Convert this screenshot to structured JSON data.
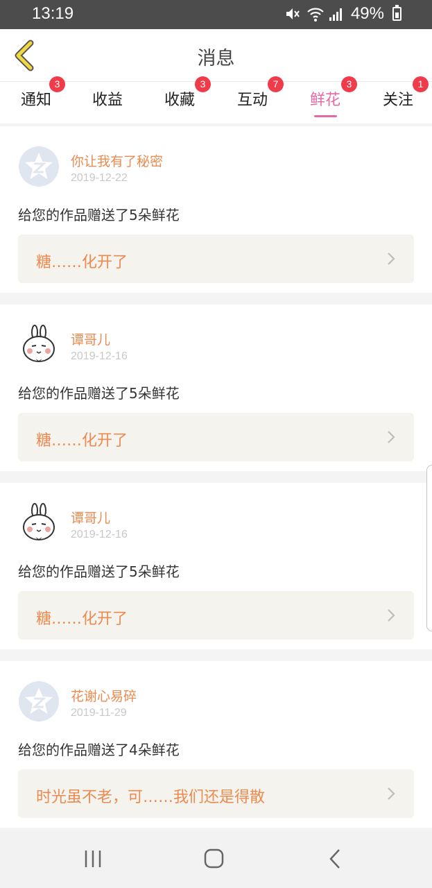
{
  "status_bar": {
    "time": "13:19",
    "battery": "49%"
  },
  "header": {
    "title": "消息"
  },
  "tabs": [
    {
      "label": "通知",
      "badge": "3",
      "active": false
    },
    {
      "label": "收益",
      "badge": "",
      "active": false
    },
    {
      "label": "收藏",
      "badge": "3",
      "active": false
    },
    {
      "label": "互动",
      "badge": "7",
      "active": false
    },
    {
      "label": "鲜花",
      "badge": "3",
      "active": true
    },
    {
      "label": "关注",
      "badge": "1",
      "active": false
    }
  ],
  "messages": [
    {
      "avatar": "qzone-avatar",
      "username": "你让我有了秘密",
      "date": "2019-12-22",
      "text": "给您的作品赠送了5朵鲜花",
      "work": "糖……化开了"
    },
    {
      "avatar": "rabbit-avatar",
      "username": "谭哥儿",
      "date": "2019-12-16",
      "text": "给您的作品赠送了5朵鲜花",
      "work": "糖……化开了"
    },
    {
      "avatar": "rabbit-avatar",
      "username": "谭哥儿",
      "date": "2019-12-16",
      "text": "给您的作品赠送了5朵鲜花",
      "work": "糖……化开了"
    },
    {
      "avatar": "qzone-avatar",
      "username": "花谢心易碎",
      "date": "2019-11-29",
      "text": "给您的作品赠送了4朵鲜花",
      "work": "时光虽不老，可……我们还是得散"
    }
  ],
  "colors": {
    "accent_pink": "#e46aa7",
    "username_orange": "#ec8a50",
    "badge_red": "#ef3b4a",
    "back_yellow": "#f0d840"
  }
}
